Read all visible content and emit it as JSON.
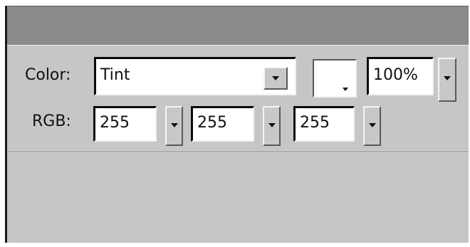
{
  "color": {
    "label": "Color:",
    "mode_value": "Tint",
    "swatch_color": "#ffffff",
    "alpha_value": "100%"
  },
  "rgb": {
    "label": "RGB:",
    "red": "255",
    "green": "255",
    "blue": "255"
  },
  "icons": {
    "dropdown": "chevron-down-icon",
    "swatch_corner": "triangle-down-icon"
  }
}
